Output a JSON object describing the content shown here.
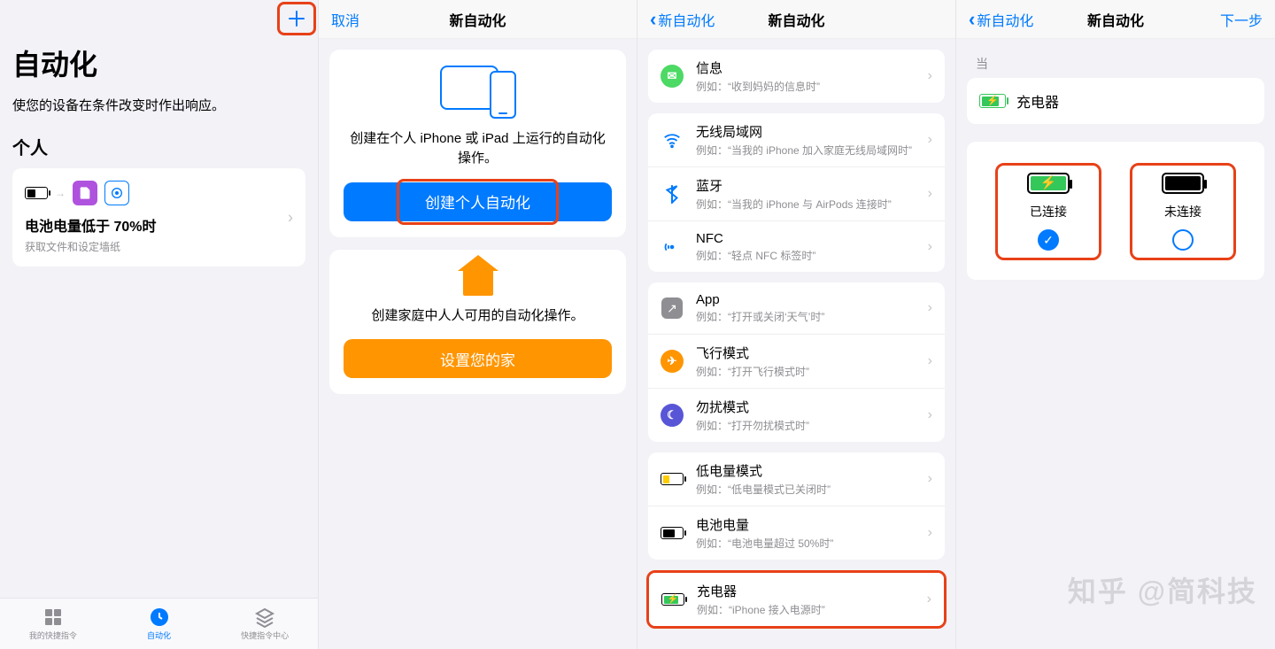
{
  "screen1": {
    "title": "自动化",
    "subtitle": "使您的设备在条件改变时作出响应。",
    "section": "个人",
    "item_title": "电池电量低于 70%时",
    "item_sub": "获取文件和设定墙纸",
    "tabs": [
      "我的快捷指令",
      "自动化",
      "快捷指令中心"
    ]
  },
  "screen2": {
    "cancel": "取消",
    "title": "新自动化",
    "personal_desc": "创建在个人 iPhone 或 iPad 上运行的自动化操作。",
    "personal_btn": "创建个人自动化",
    "home_desc": "创建家庭中人人可用的自动化操作。",
    "home_btn": "设置您的家"
  },
  "screen3": {
    "back": "新自动化",
    "title": "新自动化",
    "groups": [
      [
        {
          "icon": "msg",
          "t1": "信息",
          "t2": "例如：“收到妈妈的信息时”"
        }
      ],
      [
        {
          "icon": "wifi",
          "t1": "无线局域网",
          "t2": "例如：“当我的 iPhone 加入家庭无线局域网时”"
        },
        {
          "icon": "bt",
          "t1": "蓝牙",
          "t2": "例如：“当我的 iPhone 与 AirPods 连接时”"
        },
        {
          "icon": "nfc",
          "t1": "NFC",
          "t2": "例如：“轻点 NFC 标签时”"
        }
      ],
      [
        {
          "icon": "app",
          "t1": "App",
          "t2": "例如：“打开或关闭‘天气’时”"
        },
        {
          "icon": "plane",
          "t1": "飞行模式",
          "t2": "例如：“打开飞行模式时”"
        },
        {
          "icon": "dnd",
          "t1": "勿扰模式",
          "t2": "例如：“打开勿扰模式时”"
        }
      ],
      [
        {
          "icon": "batt-lp",
          "t1": "低电量模式",
          "t2": "例如：“低电量模式已关闭时”"
        },
        {
          "icon": "batt-lv",
          "t1": "电池电量",
          "t2": "例如：“电池电量超过 50%时”"
        }
      ]
    ],
    "charger": {
      "t1": "充电器",
      "t2": "例如：“iPhone 接入电源时”"
    }
  },
  "screen4": {
    "back": "新自动化",
    "title": "新自动化",
    "next": "下一步",
    "when": "当",
    "trigger": "充电器",
    "opt1": "已连接",
    "opt2": "未连接"
  },
  "watermark": "知乎 @简科技"
}
